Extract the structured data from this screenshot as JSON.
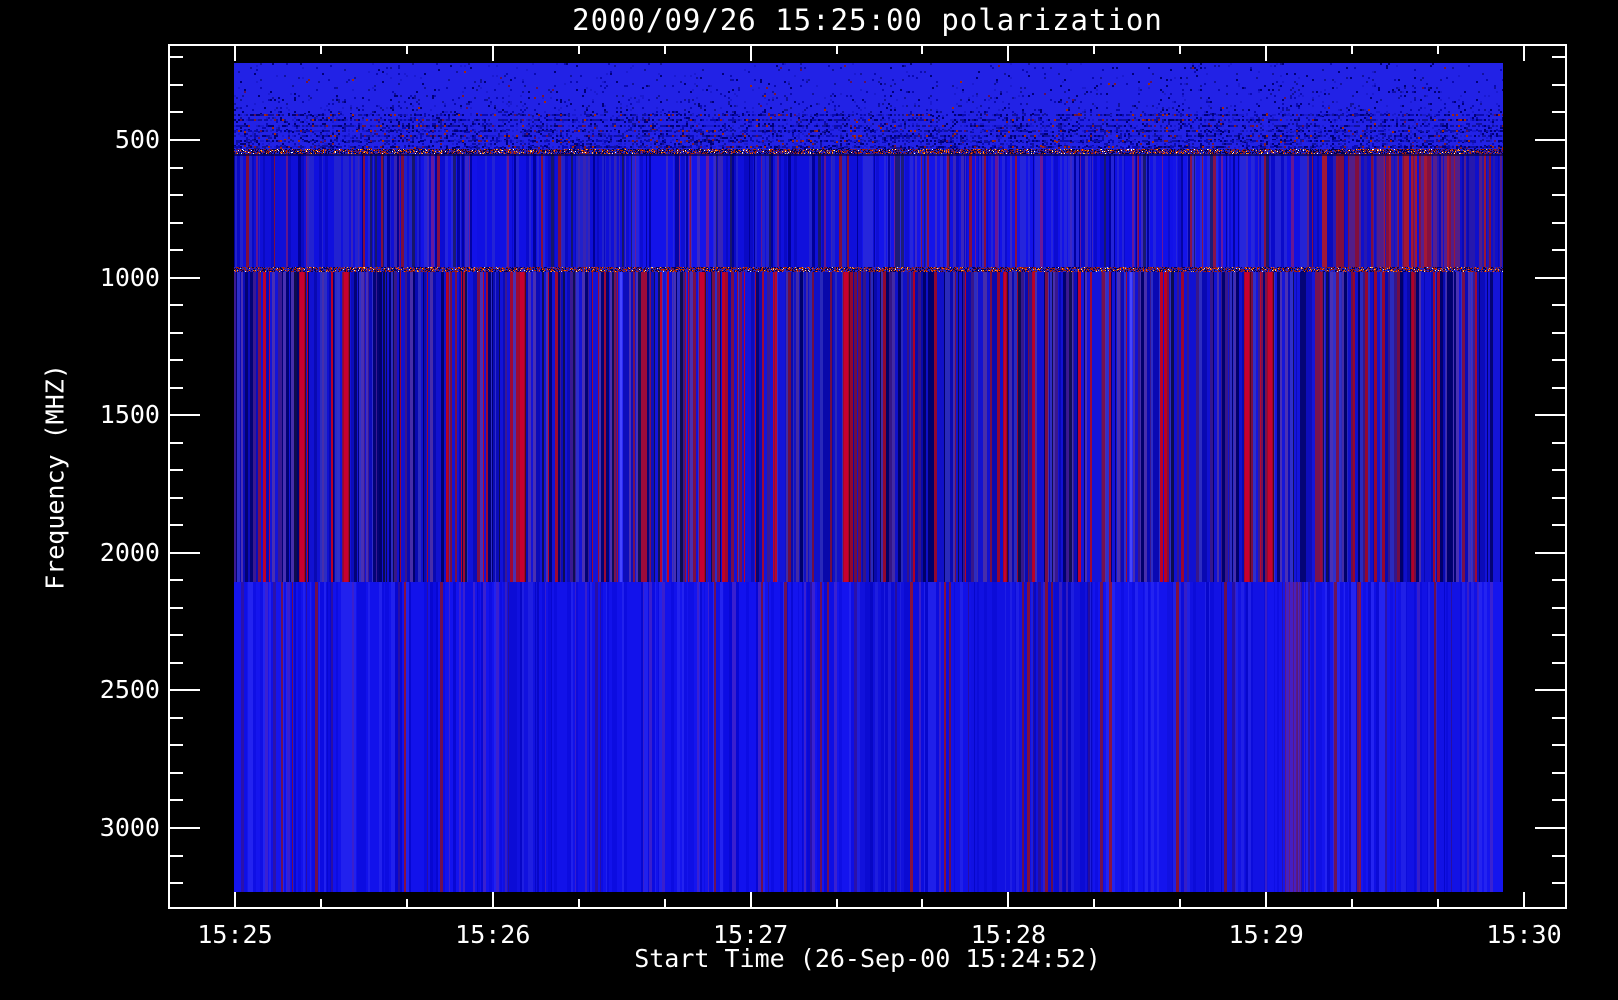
{
  "window": {
    "background": "#000000",
    "foreground": "#ffffff"
  },
  "chart_data": {
    "type": "heatmap",
    "subtype": "radio-spectrogram",
    "title": "2000/09/26 15:25:00 polarization",
    "xlabel": "Start Time (26-Sep-00 15:24:52)",
    "ylabel": "Frequency (MHZ)",
    "x_tick_labels": [
      "15:25",
      "15:26",
      "15:27",
      "15:28",
      "15:29",
      "15:30"
    ],
    "x_minor_intervals_per_major": 3,
    "x_minor_step_seconds": 20,
    "y_tick_values": [
      "500",
      "1000",
      "1500",
      "2000",
      "2500",
      "3000"
    ],
    "y_minor_step_mhz": 100,
    "y_axis_direction": "increasing-downward",
    "freq_range_mhz": [
      220,
      3232
    ],
    "time_span_minutes": 5,
    "grid": false,
    "legend": null,
    "frame": "box-with-inward-ticks",
    "features": [
      "fine vertical striping at every time sample across all bands",
      "speckled noise band 220-540 MHz with darker horizontal striations near its bottom",
      "hot-pixel speckle rows at receiver band boundaries near 540 MHz and 970 MHz",
      "dense dark red / maroon striping between 970 and 2100 MHz",
      "brighter uniform blue band 2100-3230 MHz",
      "maroon-tinted patch after ~15:29:10 in the 540-970 MHz band",
      "purple streak near 15:29:10 in the 2100-3230 MHz band",
      "strong crimson columns near 15:26:06, 15:27:22, 15:27:59 and 15:28:55"
    ],
    "render": {
      "bands": [
        {
          "name": "noise-band-220-540",
          "freq_mhz": [
            220,
            540
          ],
          "style": "noise",
          "base": "#2222e6",
          "dark_colors": [
            "#1a1ad2",
            "#12129f",
            "#000078",
            "#0a0ab4"
          ],
          "red_colors": [
            "#7a1a30",
            "#a02812",
            "#5a1060"
          ],
          "dark_rows_frac": [
            0.58,
            0.64,
            0.7,
            0.76,
            0.82,
            0.88,
            0.94
          ]
        },
        {
          "name": "band-540-970",
          "freq_mhz": [
            540,
            970
          ],
          "style": "stripes",
          "palette": [
            [
              "#1111e8",
              0.4
            ],
            [
              "#2424da",
              0.18
            ],
            [
              "#0b0bd0",
              0.14
            ],
            [
              "#0000a0",
              0.08
            ],
            [
              "#3c28c0",
              0.07
            ],
            [
              "#191970",
              0.05
            ],
            [
              "#6a1898",
              0.04
            ],
            [
              "#8a1040",
              0.04
            ]
          ],
          "right_patch": {
            "x_frac": 0.844,
            "palette": [
              [
                "#1111d8",
                0.22
              ],
              [
                "#2a1ab8",
                0.16
              ],
              [
                "#5a2090",
                0.18
              ],
              [
                "#8a1040",
                0.2
              ],
              [
                "#a81838",
                0.12
              ],
              [
                "#0b0bc0",
                0.12
              ]
            ]
          }
        },
        {
          "name": "band-970-2100",
          "freq_mhz": [
            970,
            2106
          ],
          "style": "stripes",
          "palette": [
            [
              "#1212d8",
              0.26
            ],
            [
              "#0a0ab8",
              0.13
            ],
            [
              "#000070",
              0.08
            ],
            [
              "#2e2ec8",
              0.12
            ],
            [
              "#4a30b0",
              0.09
            ],
            [
              "#3a1890",
              0.08
            ],
            [
              "#7a1048",
              0.08
            ],
            [
              "#a00830",
              0.07
            ],
            [
              "#c00028",
              0.04
            ],
            [
              "#0d0d50",
              0.05
            ]
          ],
          "crimson_columns_frac": [
            0.052,
            0.087,
            0.225,
            0.367,
            0.481,
            0.607,
            0.797,
            0.815
          ],
          "light_columns_frac": [
            0.304,
            0.706
          ]
        },
        {
          "name": "band-2100-3230",
          "freq_mhz": [
            2106,
            3232
          ],
          "style": "stripes",
          "palette": [
            [
              "#1313ee",
              0.38
            ],
            [
              "#0d0de4",
              0.2
            ],
            [
              "#2222f0",
              0.16
            ],
            [
              "#0808d4",
              0.1
            ],
            [
              "#3a20d0",
              0.07
            ],
            [
              "#2a10a8",
              0.04
            ],
            [
              "#701050",
              0.03
            ],
            [
              "#8a1240",
              0.02
            ]
          ],
          "purple_cluster": {
            "x_frac": 0.828,
            "width_frac": 0.013
          }
        }
      ],
      "boundary_rows": [
        {
          "freq_mhz": 540,
          "thickness": 5,
          "dark_underline": true,
          "palette": [
            [
              "#000050",
              0.3
            ],
            [
              "#aa2200",
              0.14
            ],
            [
              "#ff6600",
              0.05
            ],
            [
              "#ffbb44",
              0.03
            ],
            [
              "#ffffff",
              0.02
            ],
            [
              "#2222cc",
              0.28
            ],
            [
              "#551166",
              0.18
            ]
          ]
        },
        {
          "freq_mhz": 970,
          "thickness": 5,
          "dark_underline": false,
          "palette": [
            [
              "#000060",
              0.26
            ],
            [
              "#aa2200",
              0.16
            ],
            [
              "#ff5500",
              0.05
            ],
            [
              "#ffaa33",
              0.03
            ],
            [
              "#dddddd",
              0.02
            ],
            [
              "#2222cc",
              0.3
            ],
            [
              "#6a1448",
              0.18
            ]
          ]
        }
      ]
    }
  }
}
